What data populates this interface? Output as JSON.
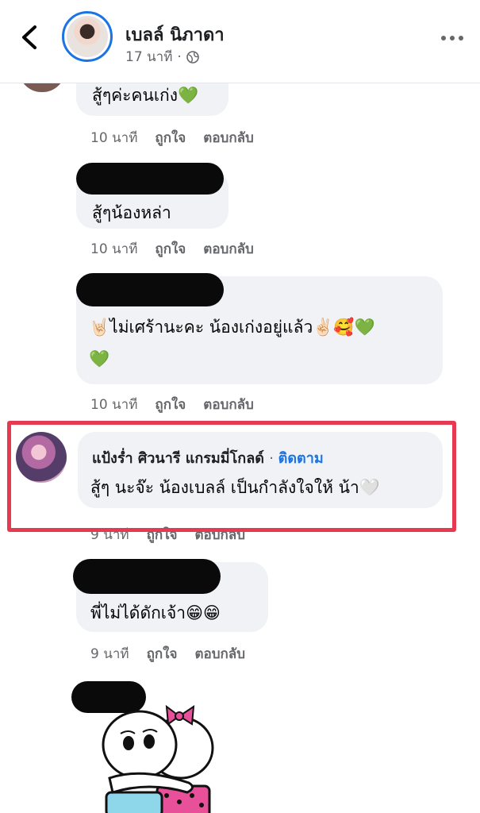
{
  "header": {
    "page_name": "เบลล์ นิภาดา",
    "post_time": "17 นาที",
    "visibility_icon": "globe-icon",
    "back_icon": "chevron-left-icon",
    "more_icon": "more-horizontal-icon"
  },
  "action_labels": {
    "like": "ถูกใจ",
    "reply": "ตอบกลับ"
  },
  "comments": [
    {
      "text": "สู้ๆค่ะคนเก่ง💚",
      "time": "10 นาที"
    },
    {
      "text": "สู้ๆน้องหล่า",
      "time": "10 นาที"
    },
    {
      "text_line1": "🤘🏻ไม่เศร้านะคะ น้องเก่งอยู่แล้ว✌🏻🥰💚",
      "text_line2": "💚",
      "time": "10 นาที"
    },
    {
      "author": "แป้งร่ำ ศิวนารี แกรมมี่โกลด์",
      "follow": "ติดตาม",
      "text": "สู้ๆ นะจ๊ะ น้องเบลล์ เป็นกำลังใจให้ น้า🤍",
      "time": "9 นาที"
    },
    {
      "text": "พี่ไม่ได้ดักเจ้า😁😁",
      "time": "9 นาที"
    }
  ],
  "colors": {
    "highlight": "#e63a52",
    "link": "#1b74e4",
    "bubble": "#f0f2f5"
  }
}
